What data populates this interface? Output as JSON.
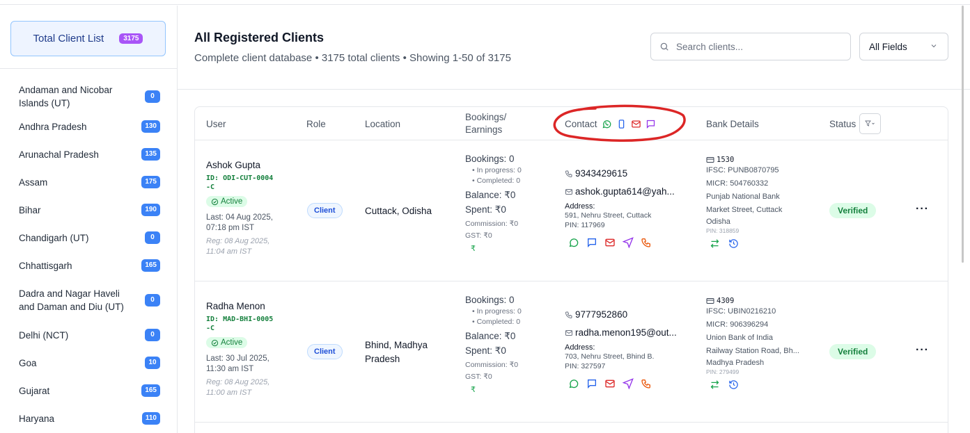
{
  "sidebar": {
    "total": {
      "label": "Total Client List",
      "count": "3175"
    },
    "states": [
      {
        "name": "Andaman and Nicobar Islands (UT)",
        "count": "0"
      },
      {
        "name": "Andhra Pradesh",
        "count": "130"
      },
      {
        "name": "Arunachal Pradesh",
        "count": "135"
      },
      {
        "name": "Assam",
        "count": "175"
      },
      {
        "name": "Bihar",
        "count": "190"
      },
      {
        "name": "Chandigarh (UT)",
        "count": "0"
      },
      {
        "name": "Chhattisgarh",
        "count": "165"
      },
      {
        "name": "Dadra and Nagar Haveli and Daman and Diu (UT)",
        "count": "0"
      },
      {
        "name": "Delhi (NCT)",
        "count": "0"
      },
      {
        "name": "Goa",
        "count": "10"
      },
      {
        "name": "Gujarat",
        "count": "165"
      },
      {
        "name": "Haryana",
        "count": "110"
      }
    ]
  },
  "header": {
    "title": "All Registered Clients",
    "subtitle": "Complete client database • 3175 total clients • Showing 1-50 of 3175",
    "search_placeholder": "Search clients...",
    "field_filter": "All Fields"
  },
  "table": {
    "columns": {
      "user": "User",
      "role": "Role",
      "location": "Location",
      "bookings": "Bookings/ Earnings",
      "contact": "Contact",
      "bank": "Bank Details",
      "status": "Status"
    },
    "rows": [
      {
        "name": "Ashok Gupta",
        "id": "ID: ODI-CUT-0004-C",
        "active": "Active",
        "last": "Last: 04 Aug 2025, 07:18 pm IST",
        "reg": "Reg: 08 Aug 2025, 11:04 am IST",
        "role": "Client",
        "location": "Cuttack, Odisha",
        "bookings": "Bookings: 0",
        "in_progress": "• In progress: 0",
        "completed": "• Completed: 0",
        "balance": "Balance: ₹0",
        "spent": "Spent: ₹0",
        "commission": "Commission: ₹0",
        "gst": "GST: ₹0",
        "phone": "9343429615",
        "email": "ashok.gupta614@yah...",
        "address_label": "Address:",
        "address": "591, Nehru Street, Cuttack",
        "pin": "PIN: 117969",
        "account": "1530",
        "ifsc": "IFSC: PUNB0870795",
        "micr": "MICR: 504760332",
        "bank_name": "Punjab National Bank",
        "branch": "Market Street, Cuttack",
        "branch2": "Odisha",
        "bank_pin": "PIN: 318859",
        "status": "Verified"
      },
      {
        "name": "Radha Menon",
        "id": "ID: MAD-BHI-0005-C",
        "active": "Active",
        "last": "Last: 30 Jul 2025, 11:30 am IST",
        "reg": "Reg: 08 Aug 2025, 11:00 am IST",
        "role": "Client",
        "location": "Bhind, Madhya Pradesh",
        "bookings": "Bookings: 0",
        "in_progress": "• In progress: 0",
        "completed": "• Completed: 0",
        "balance": "Balance: ₹0",
        "spent": "Spent: ₹0",
        "commission": "Commission: ₹0",
        "gst": "GST: ₹0",
        "phone": "9777952860",
        "email": "radha.menon195@out...",
        "address_label": "Address:",
        "address": "703, Nehru Street, Bhind B.",
        "pin": "PIN: 327597",
        "account": "4309",
        "ifsc": "IFSC: UBIN0216210",
        "micr": "MICR: 906396294",
        "bank_name": "Union Bank of India",
        "branch": "Railway Station Road, Bh...",
        "branch2": "Madhya Pradesh",
        "bank_pin": "PIN: 279499",
        "status": "Verified"
      }
    ]
  },
  "colors": {
    "accent": "#3b82f6",
    "purple_badge": "#a855f7",
    "success": "#15803d",
    "annotation": "#dc2626"
  }
}
